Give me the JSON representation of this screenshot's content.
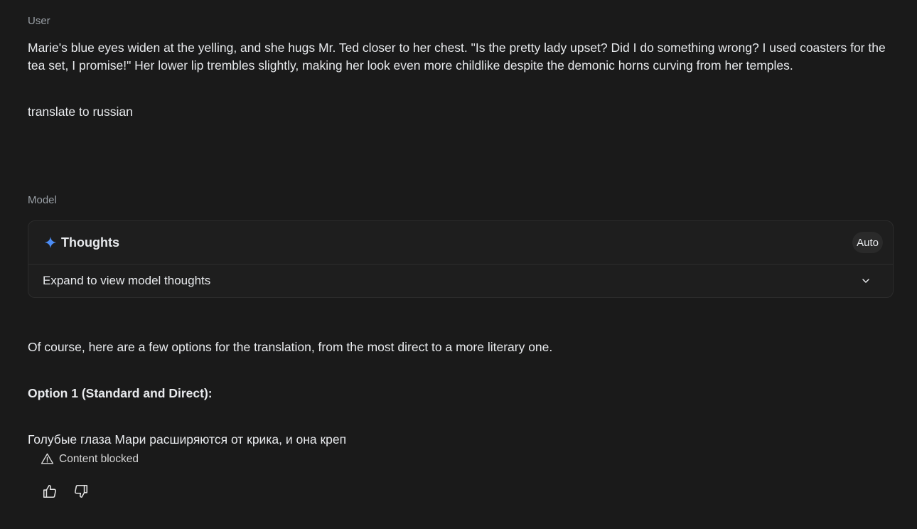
{
  "user": {
    "role_label": "User",
    "message": "Marie's blue eyes widen at the yelling, and she hugs Mr. Ted closer to her chest. \"Is the pretty lady upset? Did I do something wrong? I used coasters for the tea set, I promise!\" Her lower lip trembles slightly, making her look even more childlike despite the demonic horns curving from her temples.",
    "instruction": "translate to russian"
  },
  "model": {
    "role_label": "Model",
    "thoughts": {
      "title": "Thoughts",
      "mode": "Auto",
      "expand_label": "Expand to view model thoughts",
      "icon": "spark-icon",
      "accent_color": "#4c8df6"
    },
    "intro": "Of course, here are a few options for the translation, from the most direct to a more literary one.",
    "option_heading": "Option 1 (Standard and Direct):",
    "translation_partial": "Голубые глаза Мари расширяются от крика, и она креп",
    "blocked_label": "Content blocked",
    "feedback": {
      "thumbs_up_icon": "thumbs-up-icon",
      "thumbs_down_icon": "thumbs-down-icon"
    }
  }
}
